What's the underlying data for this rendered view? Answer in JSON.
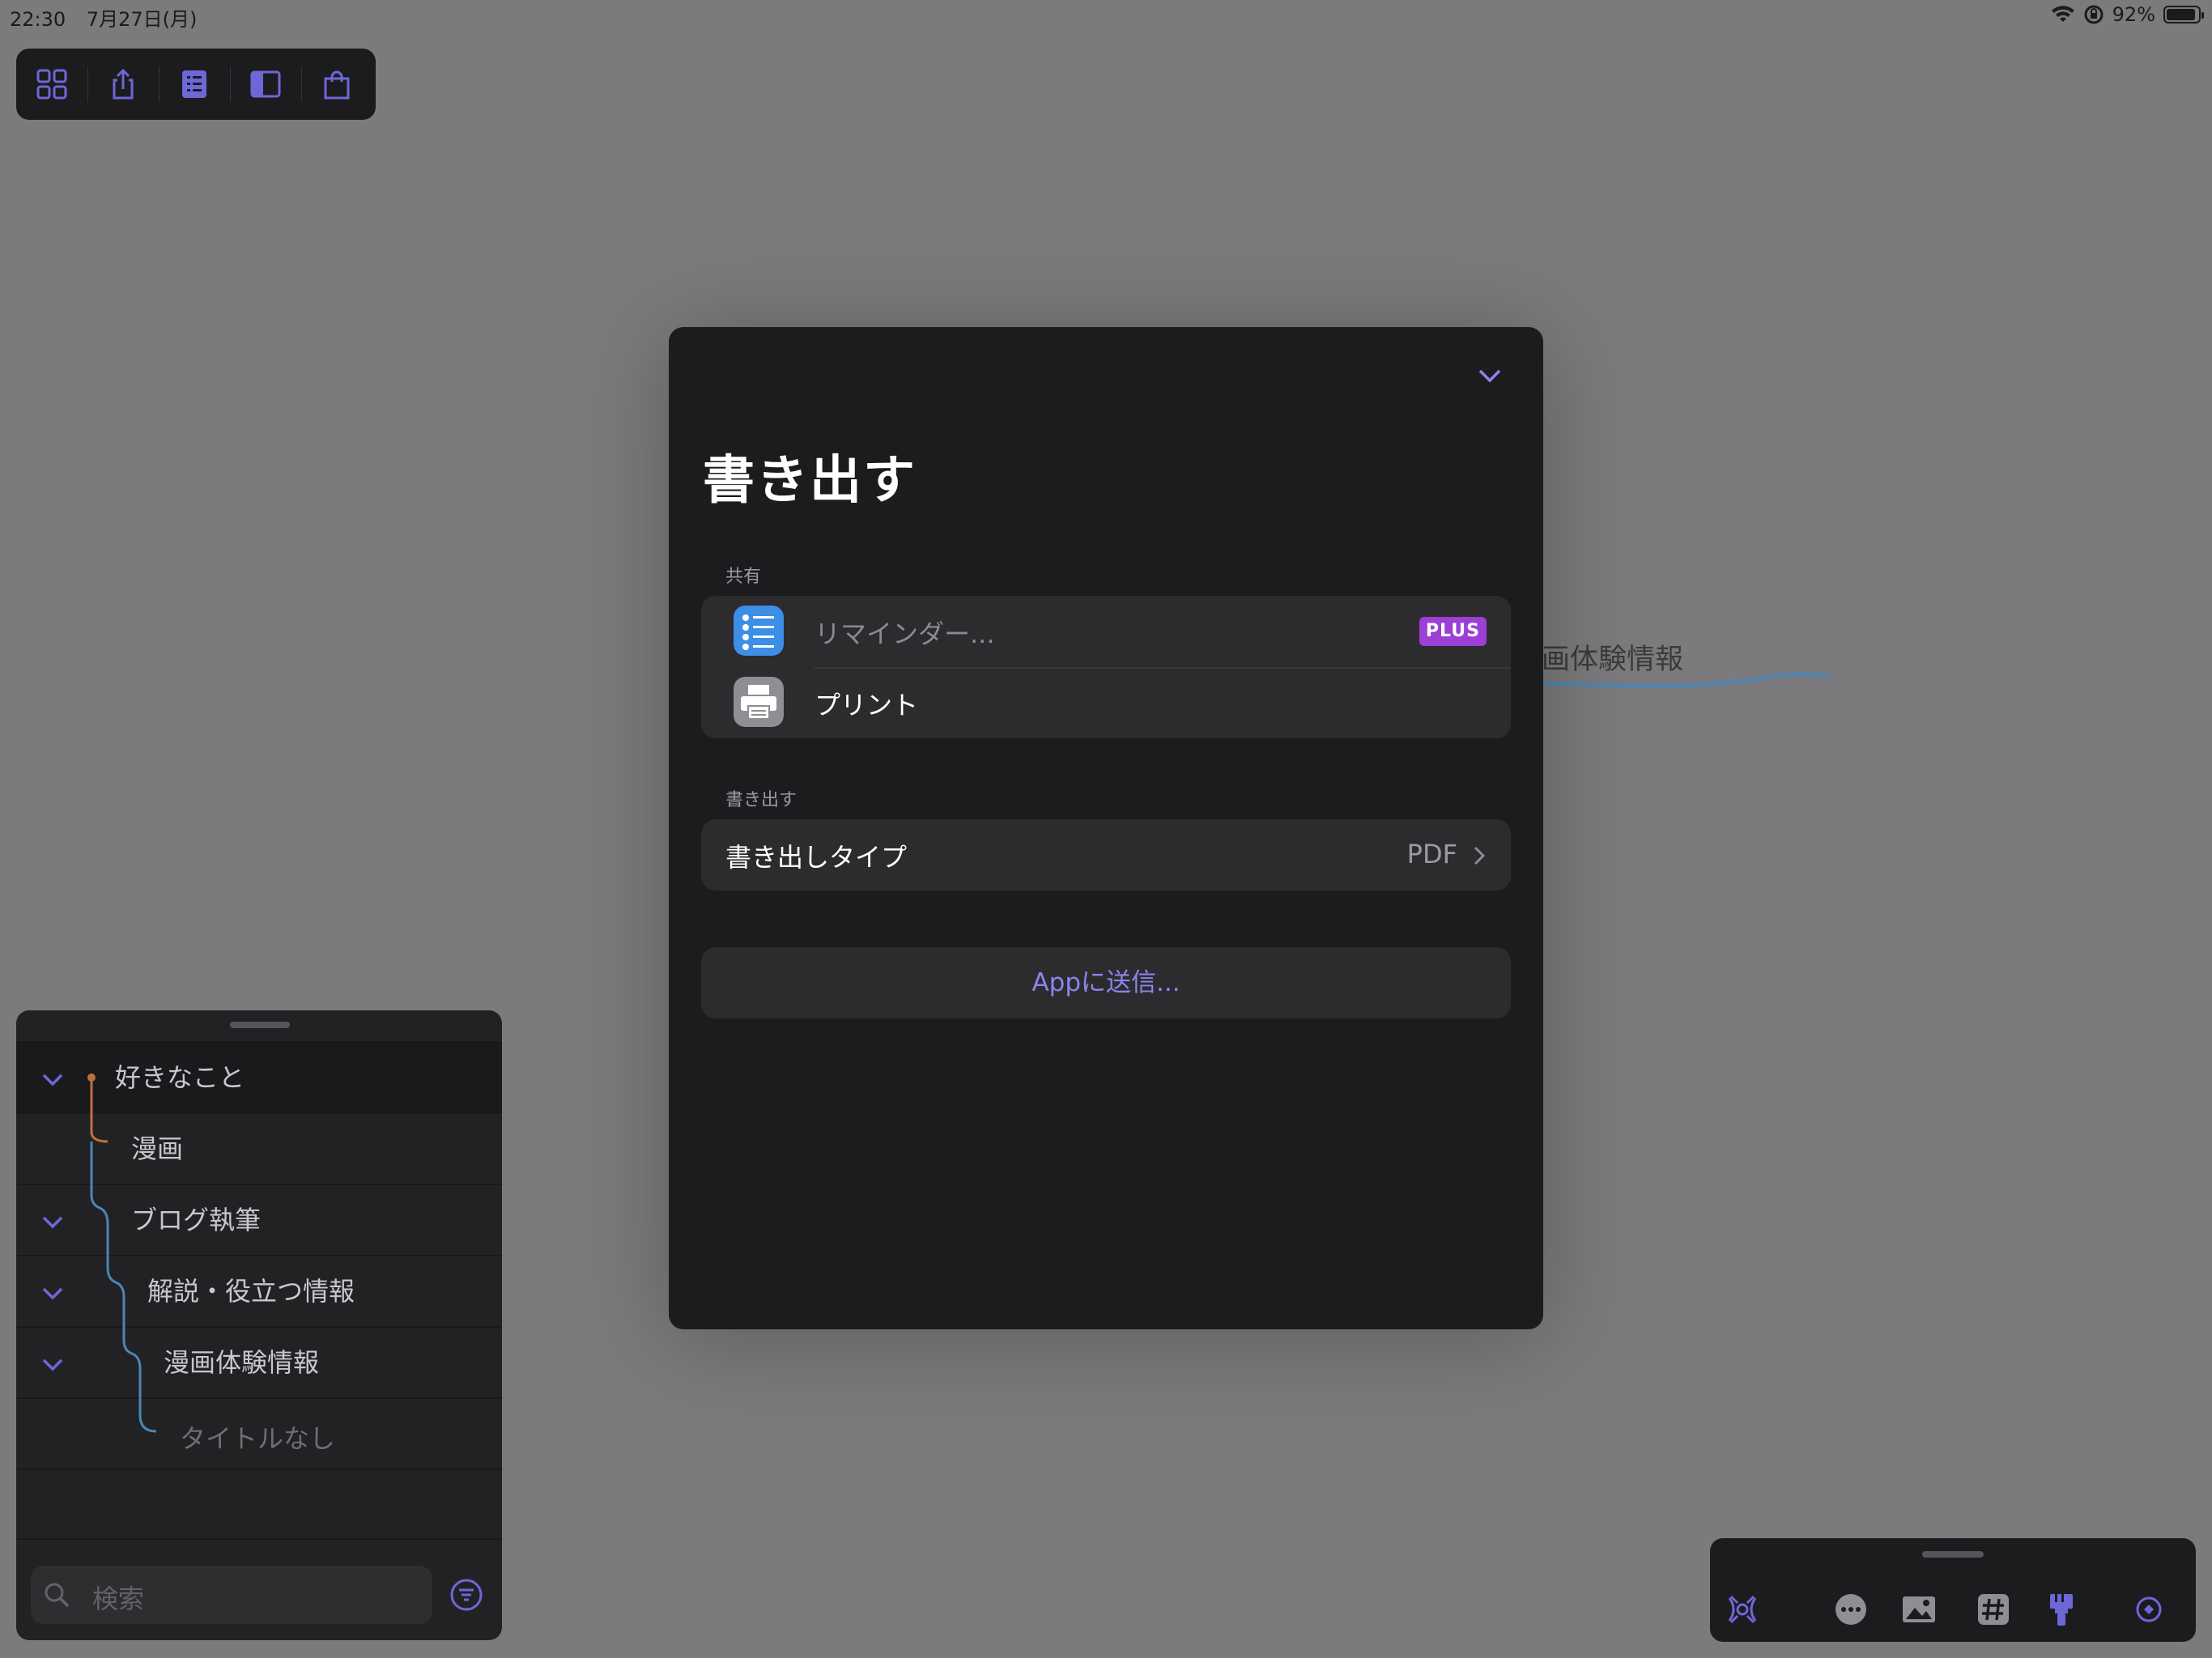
{
  "status_bar": {
    "time": "22:30",
    "date": "7月27日(月)",
    "battery": "92%"
  },
  "top_toolbar": {
    "buttons": [
      "grid-icon",
      "share-icon",
      "outline-icon",
      "sidebar-icon",
      "bag-icon"
    ],
    "accent": "#6e67d8"
  },
  "background_map": {
    "node_text": "画体験情報"
  },
  "outline": {
    "items": [
      {
        "label": "好きなこと",
        "collapsible": true
      },
      {
        "label": "漫画",
        "collapsible": false
      },
      {
        "label": "ブログ執筆",
        "collapsible": true
      },
      {
        "label": "解説・役立つ情報",
        "collapsible": true
      },
      {
        "label": "漫画体験情報",
        "collapsible": true
      },
      {
        "label": "タイトルなし",
        "collapsible": false
      }
    ],
    "search_placeholder": "検索"
  },
  "bottom_toolbar": {
    "buttons": [
      "focus-icon",
      "more-icon",
      "image-icon",
      "tag-icon",
      "style-brush-icon",
      "target-icon"
    ]
  },
  "modal": {
    "title": "書き出す",
    "share_section_label": "共有",
    "share_items": [
      {
        "label": "リマインダー...",
        "icon": "reminders-app-icon",
        "badge": "PLUS",
        "enabled": false
      },
      {
        "label": "プリント",
        "icon": "print-app-icon",
        "enabled": true
      }
    ],
    "export_section_label": "書き出す",
    "export_type_label": "書き出しタイプ",
    "export_type_value": "PDF",
    "send_to_app_label": "Appに送信...",
    "colors": {
      "accent": "#8d84ea",
      "plus_badge": "#9b3fd6",
      "reminders_icon": "#3d8ee6"
    }
  }
}
